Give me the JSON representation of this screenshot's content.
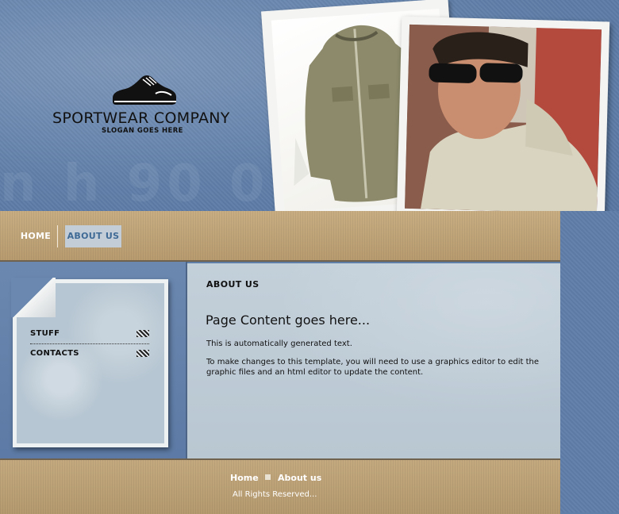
{
  "brand": {
    "company": "SPORTWEAR COMPANY",
    "slogan": "SLOGAN GOES HERE"
  },
  "nav": {
    "home": "HOME",
    "about": "ABOUT US"
  },
  "sidebar": {
    "items": [
      {
        "label": "STUFF"
      },
      {
        "label": "CONTACTS"
      }
    ]
  },
  "content": {
    "heading": "ABOUT US",
    "title": "Page Content goes here...",
    "paragraph1": "This is automatically generated text.",
    "paragraph2": "To make changes to this template, you will need to use a graphics editor to edit the graphic files and an html editor to update the content."
  },
  "footer": {
    "home": "Home",
    "about": "About us",
    "copyright": "All Rights Reserved..."
  },
  "colors": {
    "background_blue": "#5f7ea8",
    "tan_band": "#c1a67b",
    "active_tab_bg": "#c2cdd8",
    "active_tab_text": "#3f6a95",
    "content_panel": "#bfcdd8"
  },
  "icons": [
    "sneaker-logo-icon",
    "checker-arrow-icon"
  ]
}
